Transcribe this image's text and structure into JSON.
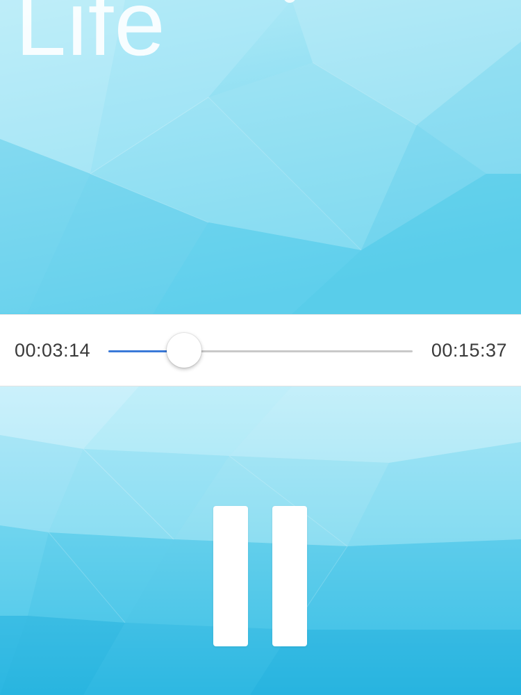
{
  "player": {
    "title": "Life",
    "elapsed": "00:03:14",
    "total": "00:15:37",
    "progress_fraction": 0.248,
    "state": "playing",
    "pause_icon": "pause-icon"
  },
  "colors": {
    "accent": "#3a79d8",
    "track": "#c9c9c9",
    "hero_light": "#b6ebf8",
    "hero_mid": "#7fd8ee",
    "lower_light": "#bdeefa",
    "lower_dark": "#29b6e0"
  }
}
